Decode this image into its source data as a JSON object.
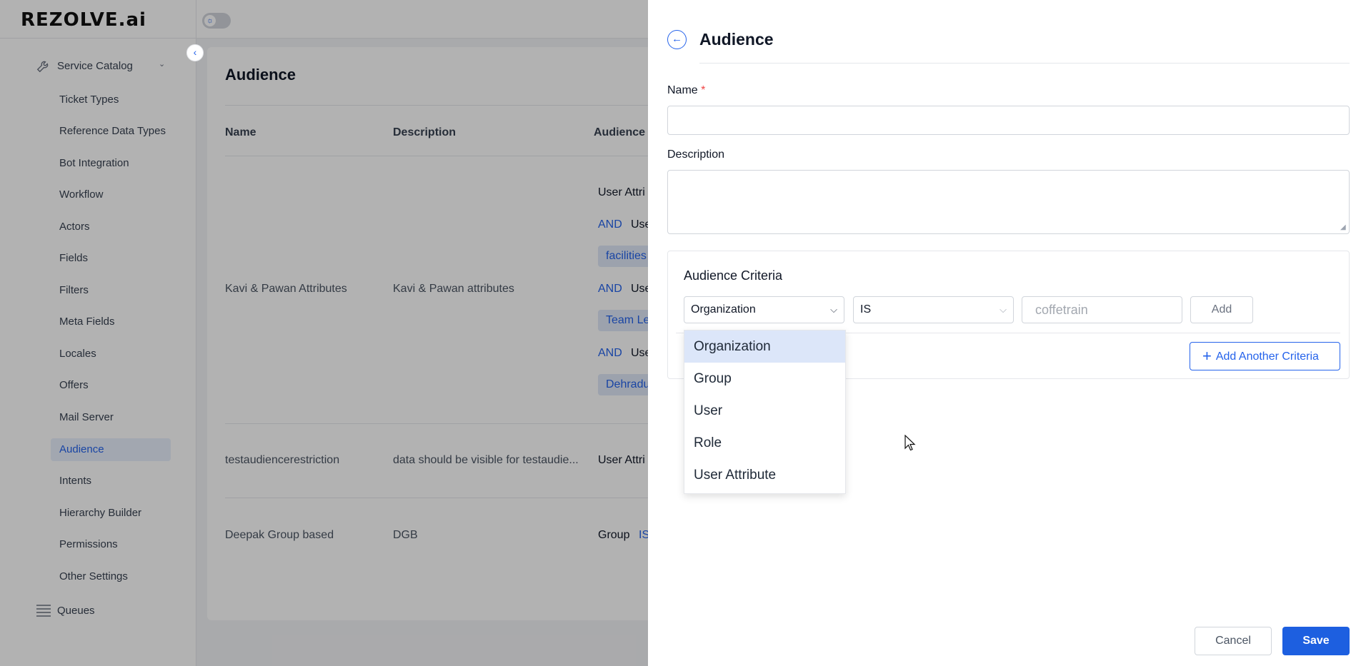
{
  "app": {
    "logo": "REZOLVE.ai"
  },
  "sidebar": {
    "group_label": "Service Catalog",
    "items": [
      {
        "label": "Ticket Types"
      },
      {
        "label": "Reference Data Types"
      },
      {
        "label": "Bot Integration"
      },
      {
        "label": "Workflow"
      },
      {
        "label": "Actors"
      },
      {
        "label": "Fields"
      },
      {
        "label": "Filters"
      },
      {
        "label": "Meta Fields"
      },
      {
        "label": "Locales"
      },
      {
        "label": "Offers"
      },
      {
        "label": "Mail Server"
      },
      {
        "label": "Audience",
        "active": true
      },
      {
        "label": "Intents"
      },
      {
        "label": "Hierarchy Builder"
      },
      {
        "label": "Permissions"
      },
      {
        "label": "Other Settings"
      }
    ],
    "queues_label": "Queues"
  },
  "page": {
    "title": "Audience",
    "columns": [
      "Name",
      "Description",
      "Audience"
    ],
    "rows": [
      {
        "name": "Kavi & Pawan Attributes",
        "description": "Kavi & Pawan attributes",
        "criteria_first": "User Attri",
        "and1": "AND",
        "and1_text": "Use",
        "chip1": "facilities",
        "and2": "AND",
        "and2_text": "Use",
        "chip2": "Team Le",
        "and3": "AND",
        "and3_text": "Use",
        "chip3": "Dehradu"
      },
      {
        "name": "testaudiencerestriction",
        "description": "data should be visible for testaudie...",
        "criteria_first": "User Attri"
      },
      {
        "name": "Deepak Group based",
        "description": "DGB",
        "criteria_first": "Group",
        "criteria_op": "IS"
      }
    ]
  },
  "drawer": {
    "title": "Audience",
    "name_label": "Name",
    "required_mark": "*",
    "name_value": "",
    "description_label": "Description",
    "description_value": "",
    "criteria": {
      "title": "Audience Criteria",
      "field_select": "Organization",
      "operator_select": "IS",
      "value_placeholder": "coffetrain",
      "add_label": "Add",
      "add_another_label": "Add Another Criteria",
      "dropdown_options": [
        "Organization",
        "Group",
        "User",
        "Role",
        "User Attribute"
      ],
      "dropdown_selected": "Organization"
    },
    "cancel_label": "Cancel",
    "save_label": "Save"
  },
  "colors": {
    "accent": "#2563eb",
    "save_bg": "#1d5fe0",
    "active_bg": "#e8effc",
    "selected_option_bg": "#dce6f9"
  },
  "icons": {
    "service_catalog": "wrench-icon",
    "queues": "list-icon",
    "back": "arrow-left-circle-icon",
    "collapse": "chevron-left-icon",
    "theme": "sun-icon"
  }
}
